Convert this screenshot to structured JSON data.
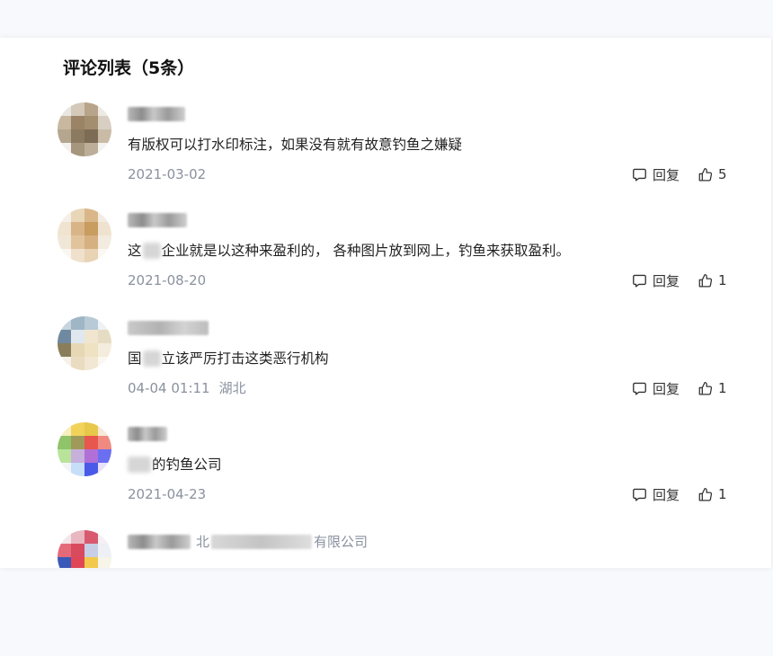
{
  "header": {
    "title": "评论列表（5条）"
  },
  "actions": {
    "reply_label": "回复"
  },
  "comments": [
    {
      "content": "有版权可以打水印标注，如果没有就有故意钓鱼之嫌疑",
      "date": "2021-03-02",
      "likes": "5",
      "avatar_colors": [
        "#e9e6e2",
        "#d4c9b8",
        "#b8a48a",
        "#ede9e3",
        "#c7b89f",
        "#9a8366",
        "#a48e70",
        "#d8cfc2",
        "#b5a690",
        "#8c7a60",
        "#7d6c55",
        "#c9bba6",
        "#f3f1ee",
        "#a6967e",
        "#bcae98",
        "#f5f3f0"
      ]
    },
    {
      "content_before": "这",
      "content_after": "企业就是以这种来盈利的， 各种图片放到网上，钓鱼来获取盈利。",
      "date": "2021-08-20",
      "likes": "1",
      "avatar_colors": [
        "#f4efe8",
        "#e9d6b8",
        "#d9b78a",
        "#f2ece3",
        "#f0e4d0",
        "#d8b487",
        "#c99c5f",
        "#efe3cf",
        "#f1e7d8",
        "#e1c49c",
        "#d6b080",
        "#f3ebdf",
        "#faf7f2",
        "#efe1cb",
        "#e8d3b5",
        "#fbf8f4"
      ]
    },
    {
      "content_before": "国",
      "content_after": "立该严厉打击这类恶行机构",
      "date": "04-04 01:11",
      "location": "湖北",
      "likes": "1",
      "avatar_colors": [
        "#c7d5de",
        "#9fb6c6",
        "#b8cad6",
        "#eef2f4",
        "#6f8aa0",
        "#dfe8ee",
        "#f0e6d0",
        "#e6dcc4",
        "#8a7e5a",
        "#e6d8b4",
        "#efe2c2",
        "#f4ecdc",
        "#f6f2ea",
        "#e9dcc0",
        "#f1e7d2",
        "#faf7f1"
      ]
    },
    {
      "content_after": "的钓鱼公司",
      "date": "2021-04-23",
      "likes": "1",
      "avatar_colors": [
        "#f7efc0",
        "#f2d35a",
        "#e7c84a",
        "#f7e9d8",
        "#8fc46a",
        "#a09a5a",
        "#e8574e",
        "#f08a80",
        "#b9e39a",
        "#c8b0dc",
        "#b070d8",
        "#6a6ef0",
        "#f4f4f8",
        "#c7def8",
        "#4a5ae8",
        "#e9e0fa"
      ]
    },
    {
      "name_visible": [
        "北",
        "有限公司"
      ],
      "avatar_colors": [
        "#f3e6ea",
        "#e9b7c0",
        "#d95a6e",
        "#f4f0f4",
        "#e46a7a",
        "#d84a5e",
        "#c6cfe6",
        "#eef0f6",
        "#3a58b8",
        "#e04656",
        "#f2c94c",
        "#f7f4e8",
        "#f6f6fa",
        "#5a6ac8",
        "#f3d46a",
        "#faf8f0"
      ]
    }
  ]
}
